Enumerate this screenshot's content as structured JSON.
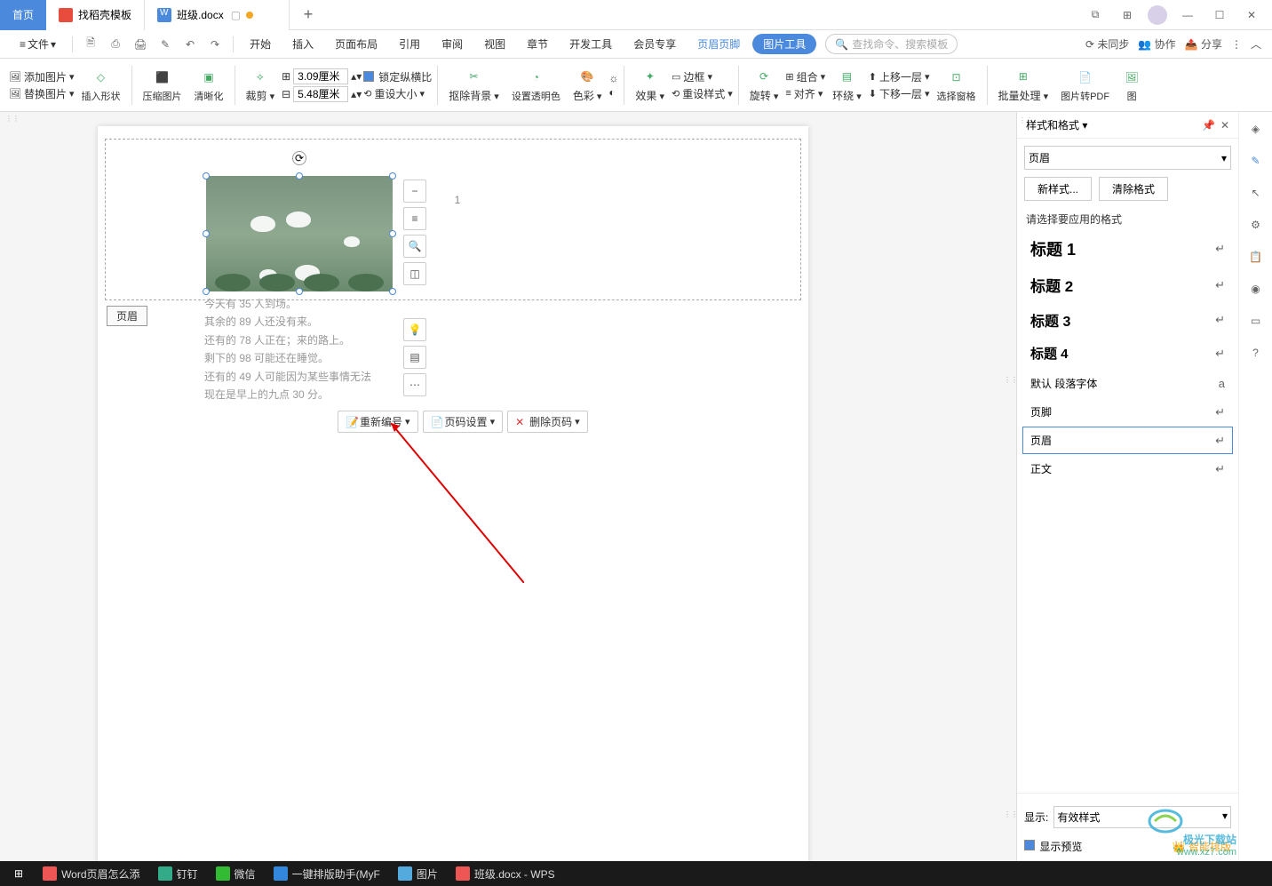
{
  "tabs": {
    "home": "首页",
    "template": "找稻壳模板",
    "doc": "班级.docx"
  },
  "menu": {
    "file": "文件",
    "items": [
      "开始",
      "插入",
      "页面布局",
      "引用",
      "审阅",
      "视图",
      "章节",
      "开发工具",
      "会员专享"
    ],
    "header_footer": "页眉页脚",
    "picture_tools": "图片工具",
    "search_ph": "查找命令、搜索模板",
    "unsync": "未同步",
    "collab": "协作",
    "share": "分享"
  },
  "ribbon": {
    "add_pic": "添加图片",
    "replace_pic": "替换图片",
    "insert_shape": "插入形状",
    "compress": "压缩图片",
    "clarity": "清晰化",
    "crop": "裁剪",
    "h_icon": "⊞",
    "w_icon": "⊟",
    "height": "3.09厘米",
    "width": "5.48厘米",
    "lock_ratio": "锁定纵横比",
    "reset_size": "重设大小",
    "remove_bg": "抠除背景",
    "set_transparent": "设置透明色",
    "color": "色彩",
    "artistic1": "☼",
    "artistic2": "◐",
    "effects": "效果",
    "border": "边框",
    "reset_style": "重设样式",
    "rotate": "旋转",
    "group": "组合",
    "align": "对齐",
    "wrap": "环绕",
    "up_layer": "上移一层",
    "down_layer": "下移一层",
    "select_pane": "选择窗格",
    "batch": "批量处理",
    "to_pdf": "图片转PDF",
    "pic_cut": "图"
  },
  "doc": {
    "page_num": "1",
    "header_label": "页眉",
    "lines": [
      "今天有 35 人到场。",
      "其余的 89 人还没有来。",
      "还有的 78 人正在；来的路上。",
      "剩下的 98 可能还在睡觉。",
      "还有的 49 人可能因为某些事情无法",
      "现在是早上的九点 30 分。"
    ]
  },
  "context": {
    "renumber": "重新编号",
    "page_setup": "页码设置",
    "delete_num": "删除页码"
  },
  "panel": {
    "title": "样式和格式",
    "current": "页眉",
    "new_style": "新样式...",
    "clear": "清除格式",
    "apply_label": "请选择要应用的格式",
    "styles": [
      {
        "name": "标题 1",
        "cls": "h1"
      },
      {
        "name": "标题 2",
        "cls": "h2"
      },
      {
        "name": "标题 3",
        "cls": "h3"
      },
      {
        "name": "标题 4",
        "cls": "h4"
      },
      {
        "name": "默认 段落字体",
        "cls": ""
      },
      {
        "name": "页脚",
        "cls": ""
      },
      {
        "name": "页眉",
        "cls": "",
        "sel": true
      },
      {
        "name": "正文",
        "cls": ""
      }
    ],
    "show": "显示:",
    "show_val": "有效样式",
    "preview": "显示预览",
    "smart": "智能排版"
  },
  "taskbar": {
    "items": [
      {
        "label": "Word页眉怎么添",
        "color": "#e55"
      },
      {
        "label": "钉钉",
        "color": "#3a8"
      },
      {
        "label": "微信",
        "color": "#3b3"
      },
      {
        "label": "一键排版助手(MyF",
        "color": "#38d"
      },
      {
        "label": "图片",
        "color": "#5ad"
      },
      {
        "label": "班级.docx - WPS",
        "color": "#e55"
      }
    ]
  },
  "watermark": {
    "name": "极光下载站",
    "url": "www.xz7.com"
  }
}
